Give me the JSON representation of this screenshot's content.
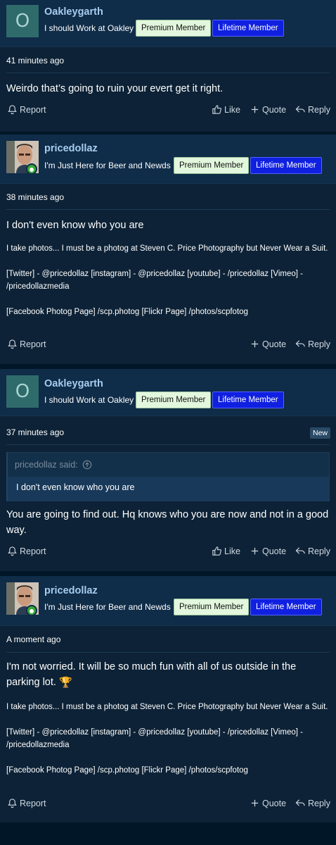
{
  "posts": [
    {
      "avatar_letter": "O",
      "username": "Oakleygarth",
      "user_title": "I should Work at Oakley",
      "badge_premium": "Premium Member",
      "badge_lifetime": "Lifetime Member",
      "time": "41 minutes ago",
      "body": "Weirdo that’s going to ruin your evert get it right.",
      "actions": {
        "report": "Report",
        "like": "Like",
        "quote": "Quote",
        "reply": "Reply"
      }
    },
    {
      "username": "pricedollaz",
      "user_title": "I'm Just Here for Beer and Newds",
      "badge_premium": "Premium Member",
      "badge_lifetime": "Lifetime Member",
      "time": "38 minutes ago",
      "body": "I don't even know who you are",
      "signature": {
        "line1": "I take photos... I must be a photog at Steven C. Price Photography but Never Wear a Suit.",
        "line2": "[Twitter] - @pricedollaz [instagram] - @pricedollaz [youtube] - /pricedollaz [Vimeo] - /pricedollazmedia",
        "line3": "[Facebook Photog Page] /scp.photog [Flickr Page] /photos/scpfotog"
      },
      "actions": {
        "report": "Report",
        "quote": "Quote",
        "reply": "Reply"
      }
    },
    {
      "avatar_letter": "O",
      "username": "Oakleygarth",
      "user_title": "I should Work at Oakley",
      "badge_premium": "Premium Member",
      "badge_lifetime": "Lifetime Member",
      "time": "37 minutes ago",
      "new_badge": "New",
      "quote": {
        "author": "pricedollaz said:",
        "text": "I don't even know who you are"
      },
      "body": "You are going to find out. Hq knows who you are now and not in a good way.",
      "actions": {
        "report": "Report",
        "like": "Like",
        "quote": "Quote",
        "reply": "Reply"
      }
    },
    {
      "username": "pricedollaz",
      "user_title": "I'm Just Here for Beer and Newds",
      "badge_premium": "Premium Member",
      "badge_lifetime": "Lifetime Member",
      "time": "A moment ago",
      "body": "I'm not worried. It will be so much fun with all of us outside in the parking lot.",
      "signature": {
        "line1": "I take photos... I must be a photog at Steven C. Price Photography but Never Wear a Suit.",
        "line2": "[Twitter] - @pricedollaz [instagram] - @pricedollaz [youtube] - /pricedollaz [Vimeo] - /pricedollazmedia",
        "line3": "[Facebook Photog Page] /scp.photog [Flickr Page] /photos/scpfotog"
      },
      "actions": {
        "report": "Report",
        "quote": "Quote",
        "reply": "Reply"
      }
    }
  ],
  "icons": {
    "report": "bell-icon",
    "like": "thumbs-up-icon",
    "quote": "plus-icon",
    "reply": "reply-arrow-icon",
    "quote_up": "arrow-up-circle-icon",
    "online": "online-status-icon",
    "trophy": "trophy-icon"
  },
  "colors": {
    "background": "#011627",
    "post": "#0d2236",
    "header": "#0f2c48",
    "username": "#a7cdf0",
    "premium_badge": "#e2f7dd",
    "lifetime_badge": "#1020e0",
    "online": "#38a936"
  }
}
